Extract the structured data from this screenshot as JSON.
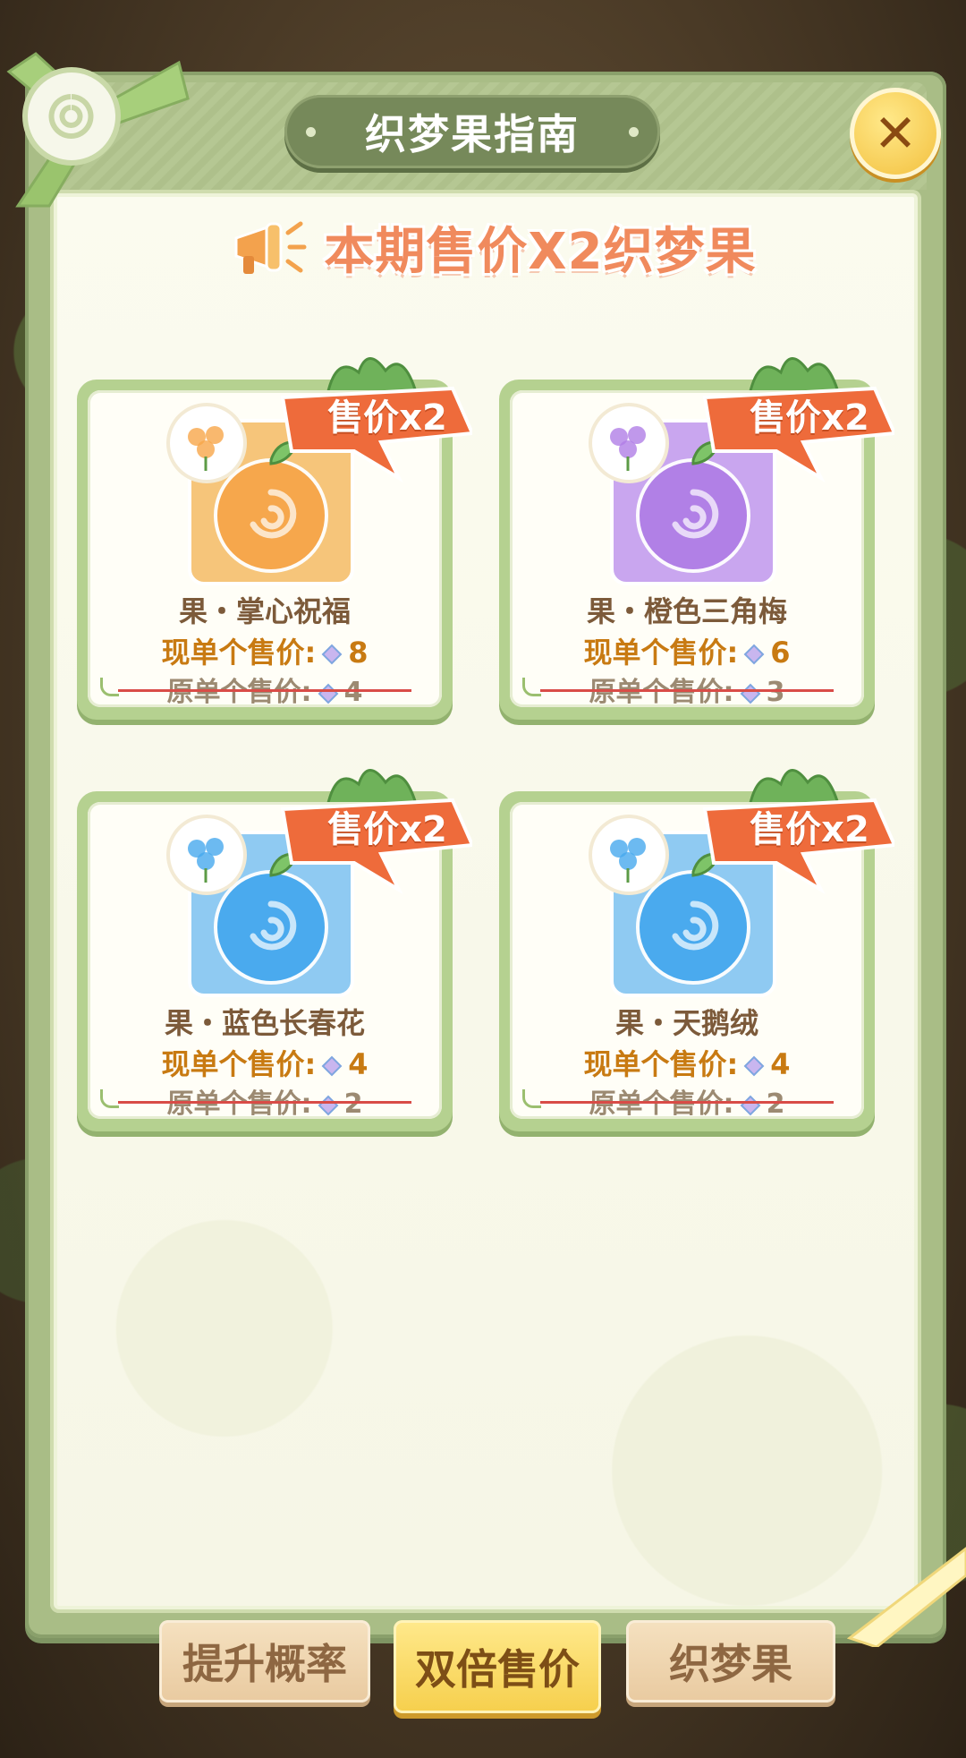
{
  "dialog": {
    "title": "织梦果指南",
    "close_icon": "close-icon",
    "headline": "本期售价X2织梦果"
  },
  "cards": [
    {
      "ribbon": "售价x2",
      "name": "果・掌心祝福",
      "now_label": "现单个售价:",
      "now_value": "8",
      "old_label": "原单个售价:",
      "old_value": "4",
      "fruit_color": "#f7a64a",
      "frame_color": "#f6c57a"
    },
    {
      "ribbon": "售价x2",
      "name": "果・橙色三角梅",
      "now_label": "现单个售价:",
      "now_value": "6",
      "old_label": "原单个售价:",
      "old_value": "3",
      "fruit_color": "#b07ee6",
      "frame_color": "#c9a6ef"
    },
    {
      "ribbon": "售价x2",
      "name": "果・蓝色长春花",
      "now_label": "现单个售价:",
      "now_value": "4",
      "old_label": "原单个售价:",
      "old_value": "2",
      "fruit_color": "#47a9ee",
      "frame_color": "#8fcaf2"
    },
    {
      "ribbon": "售价x2",
      "name": "果・天鹅绒",
      "now_label": "现单个售价:",
      "now_value": "4",
      "old_label": "原单个售价:",
      "old_value": "2",
      "fruit_color": "#47a9ee",
      "frame_color": "#8fcaf2"
    }
  ],
  "tabs": [
    {
      "label": "提升概率",
      "active": false
    },
    {
      "label": "双倍售价",
      "active": true
    },
    {
      "label": "织梦果",
      "active": false
    }
  ],
  "colors": {
    "accent": "#f08a5d",
    "panel": "#a9bd86",
    "price_now": "#c87a12"
  }
}
